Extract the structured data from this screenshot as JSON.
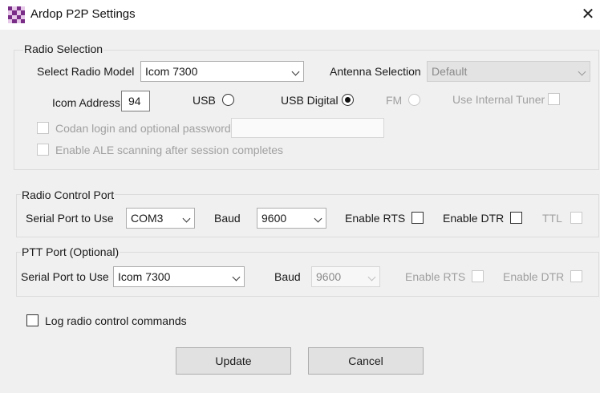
{
  "window": {
    "title": "Ardop P2P Settings"
  },
  "radio_selection": {
    "group_title": "Radio Selection",
    "select_radio_model_label": "Select Radio Model",
    "radio_model_value": "Icom 7300",
    "antenna_selection_label": "Antenna Selection",
    "antenna_value": "Default",
    "icom_address_label": "Icom Address",
    "icom_address_value": "94",
    "usb_label": "USB",
    "usb_digital_label": "USB Digital",
    "fm_label": "FM",
    "use_internal_tuner_label": "Use Internal Tuner",
    "codan_label": "Codan login and optional password:",
    "ale_label": "Enable ALE scanning after session completes",
    "mode_selected": "USB Digital"
  },
  "radio_control_port": {
    "group_title": "Radio Control Port",
    "serial_port_label": "Serial Port to Use",
    "serial_port_value": "COM3",
    "baud_label": "Baud",
    "baud_value": "9600",
    "enable_rts_label": "Enable RTS",
    "enable_dtr_label": "Enable DTR",
    "ttl_label": "TTL"
  },
  "ptt_port": {
    "group_title": "PTT Port (Optional)",
    "serial_port_label": "Serial Port to Use",
    "serial_port_value": "Icom 7300",
    "baud_label": "Baud",
    "baud_value": "9600",
    "enable_rts_label": "Enable RTS",
    "enable_dtr_label": "Enable DTR"
  },
  "log_label": "Log radio control commands",
  "buttons": {
    "update": "Update",
    "cancel": "Cancel"
  }
}
